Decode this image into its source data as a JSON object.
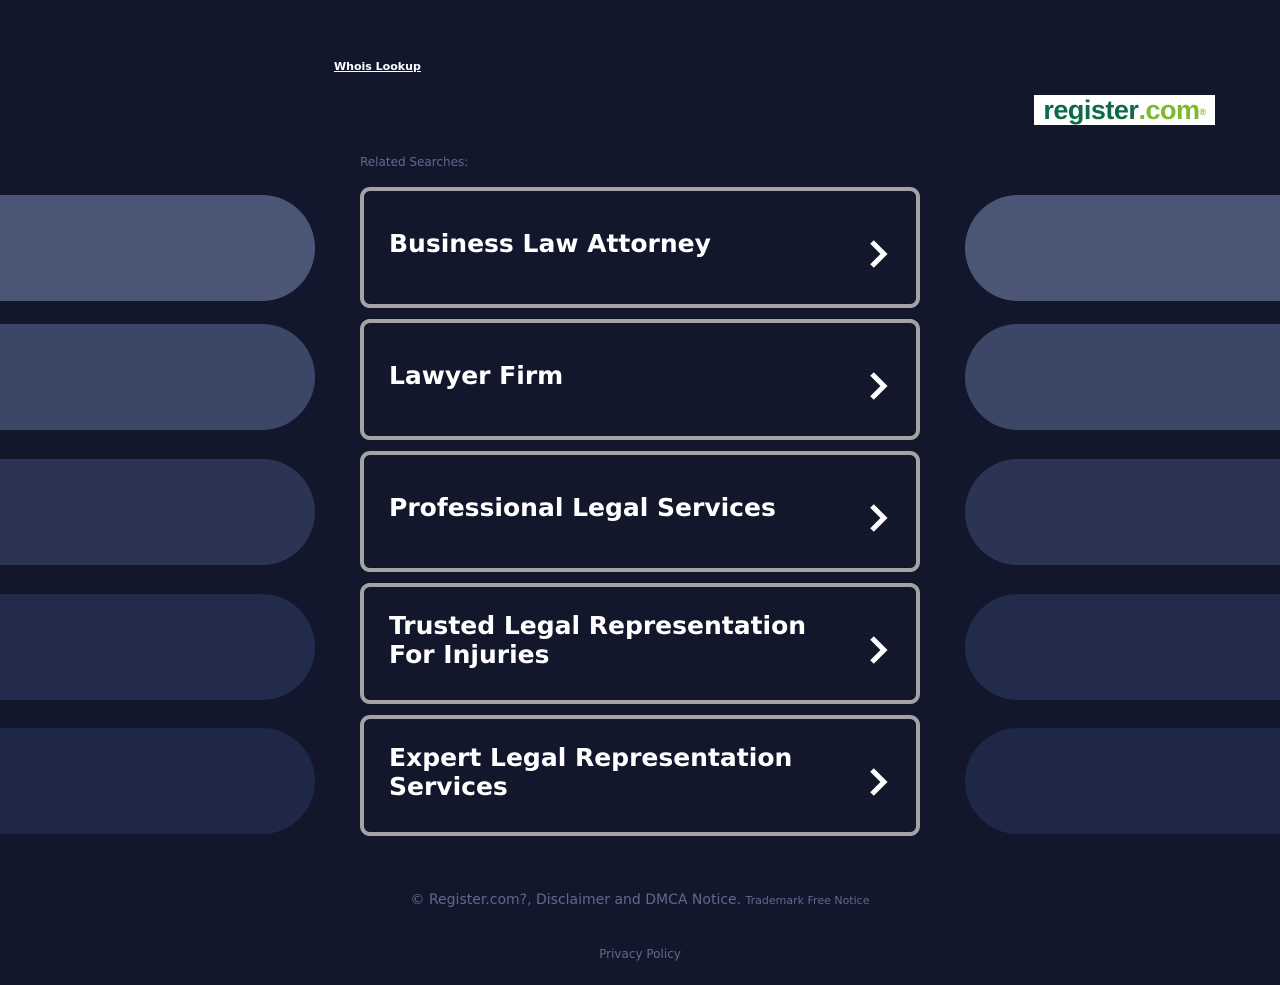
{
  "header": {
    "whois_link": "Whois Lookup",
    "logo": {
      "part1": "register",
      "part2": ".com",
      "mark": "®"
    }
  },
  "related": {
    "label": "Related Searches:"
  },
  "results": [
    {
      "label": "Business Law Attorney"
    },
    {
      "label": "Lawyer Firm"
    },
    {
      "label": "Professional Legal Services"
    },
    {
      "label": "Trusted Legal Representation For Injuries"
    },
    {
      "label": "Expert Legal Representation Services"
    }
  ],
  "footer": {
    "copyright": "© Register.com?, Disclaimer and DMCA Notice.",
    "trademark": "Trademark Free Notice",
    "privacy": "Privacy Policy"
  },
  "colors": {
    "background": "#12172c",
    "card_border": "#a3a3a6",
    "muted_text": "#5d6a8d",
    "logo_green_dark": "#0d6b48",
    "logo_green_light": "#7cb92f"
  },
  "icons": {
    "result_arrow": "chevron-right-icon"
  }
}
